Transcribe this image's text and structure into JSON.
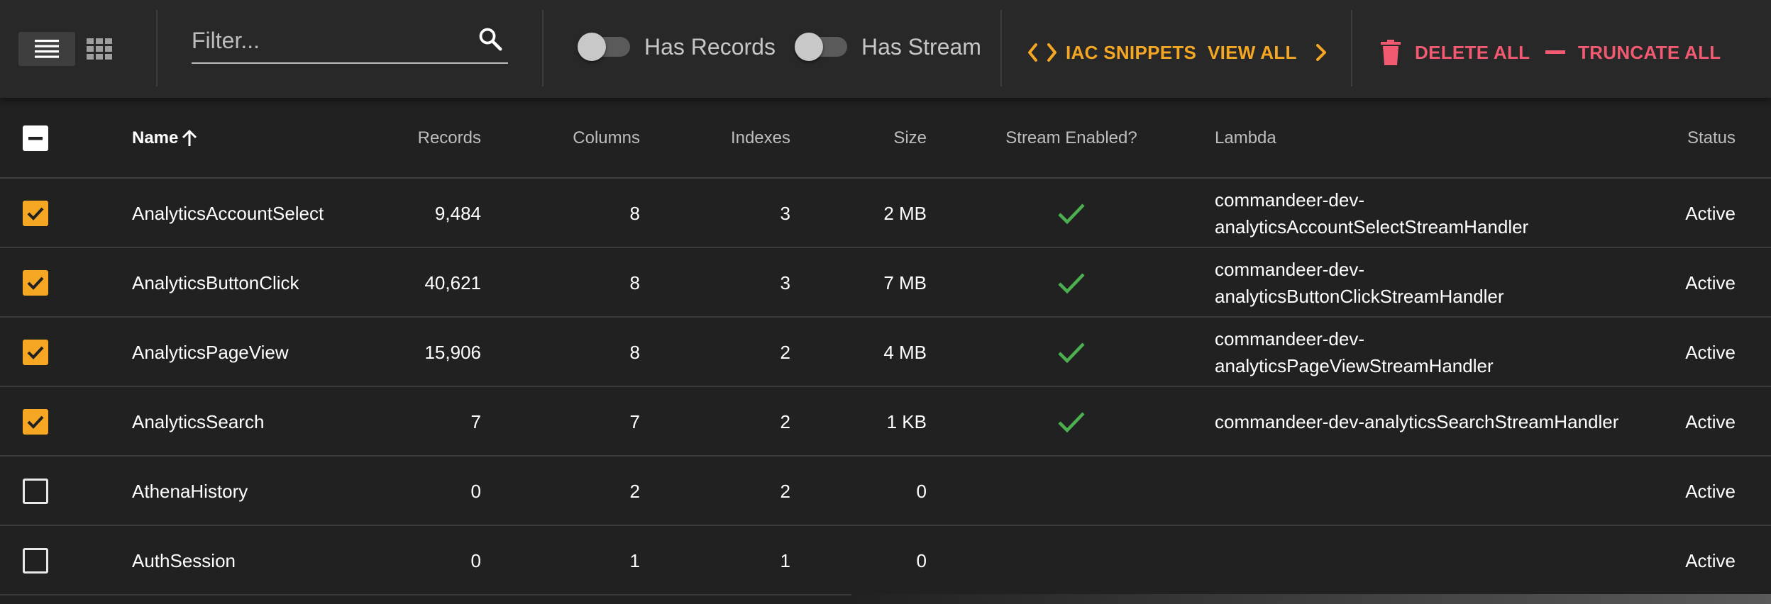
{
  "toolbar": {
    "filter_placeholder": "Filter...",
    "has_records_label": "Has Records",
    "has_stream_label": "Has Stream",
    "iac_snippets_label": "IAC SNIPPETS",
    "view_all_label": "VIEW ALL",
    "delete_all_label": "DELETE ALL",
    "truncate_all_label": "TRUNCATE ALL"
  },
  "columns": {
    "name": "Name",
    "records": "Records",
    "columns": "Columns",
    "indexes": "Indexes",
    "size": "Size",
    "stream_enabled": "Stream Enabled?",
    "lambda": "Lambda",
    "status": "Status"
  },
  "rows": [
    {
      "checked": true,
      "name": "AnalyticsAccountSelect",
      "records": "9,484",
      "columns": "8",
      "indexes": "3",
      "size": "2 MB",
      "stream": true,
      "lambda_line1": "commandeer-dev-",
      "lambda_line2": "analyticsAccountSelectStreamHandler",
      "status": "Active"
    },
    {
      "checked": true,
      "name": "AnalyticsButtonClick",
      "records": "40,621",
      "columns": "8",
      "indexes": "3",
      "size": "7 MB",
      "stream": true,
      "lambda_line1": "commandeer-dev-",
      "lambda_line2": "analyticsButtonClickStreamHandler",
      "status": "Active"
    },
    {
      "checked": true,
      "name": "AnalyticsPageView",
      "records": "15,906",
      "columns": "8",
      "indexes": "2",
      "size": "4 MB",
      "stream": true,
      "lambda_line1": "commandeer-dev-",
      "lambda_line2": "analyticsPageViewStreamHandler",
      "status": "Active"
    },
    {
      "checked": true,
      "name": "AnalyticsSearch",
      "records": "7",
      "columns": "7",
      "indexes": "2",
      "size": "1 KB",
      "stream": true,
      "lambda_line1": "commandeer-dev-analyticsSearchStreamHandler",
      "lambda_line2": "",
      "status": "Active"
    },
    {
      "checked": false,
      "name": "AthenaHistory",
      "records": "0",
      "columns": "2",
      "indexes": "2",
      "size": "0",
      "stream": false,
      "lambda_line1": "",
      "lambda_line2": "",
      "status": "Active"
    },
    {
      "checked": false,
      "name": "AuthSession",
      "records": "0",
      "columns": "1",
      "indexes": "1",
      "size": "0",
      "stream": false,
      "lambda_line1": "",
      "lambda_line2": "",
      "status": "Active"
    }
  ],
  "colors": {
    "accent_orange": "#f5a623",
    "danger_red": "#f25a71",
    "check_green": "#4caf50",
    "background": "#212121",
    "toolbar": "#282828"
  },
  "icons": {
    "list_view": "list-view-icon",
    "grid_view": "grid-view-icon",
    "search": "search-icon",
    "code": "code-icon",
    "chevron_right": "chevron-right-icon",
    "trash": "trash-icon",
    "minus": "minus-icon",
    "sort": "arrow-up-icon",
    "check": "checkmark-icon"
  }
}
